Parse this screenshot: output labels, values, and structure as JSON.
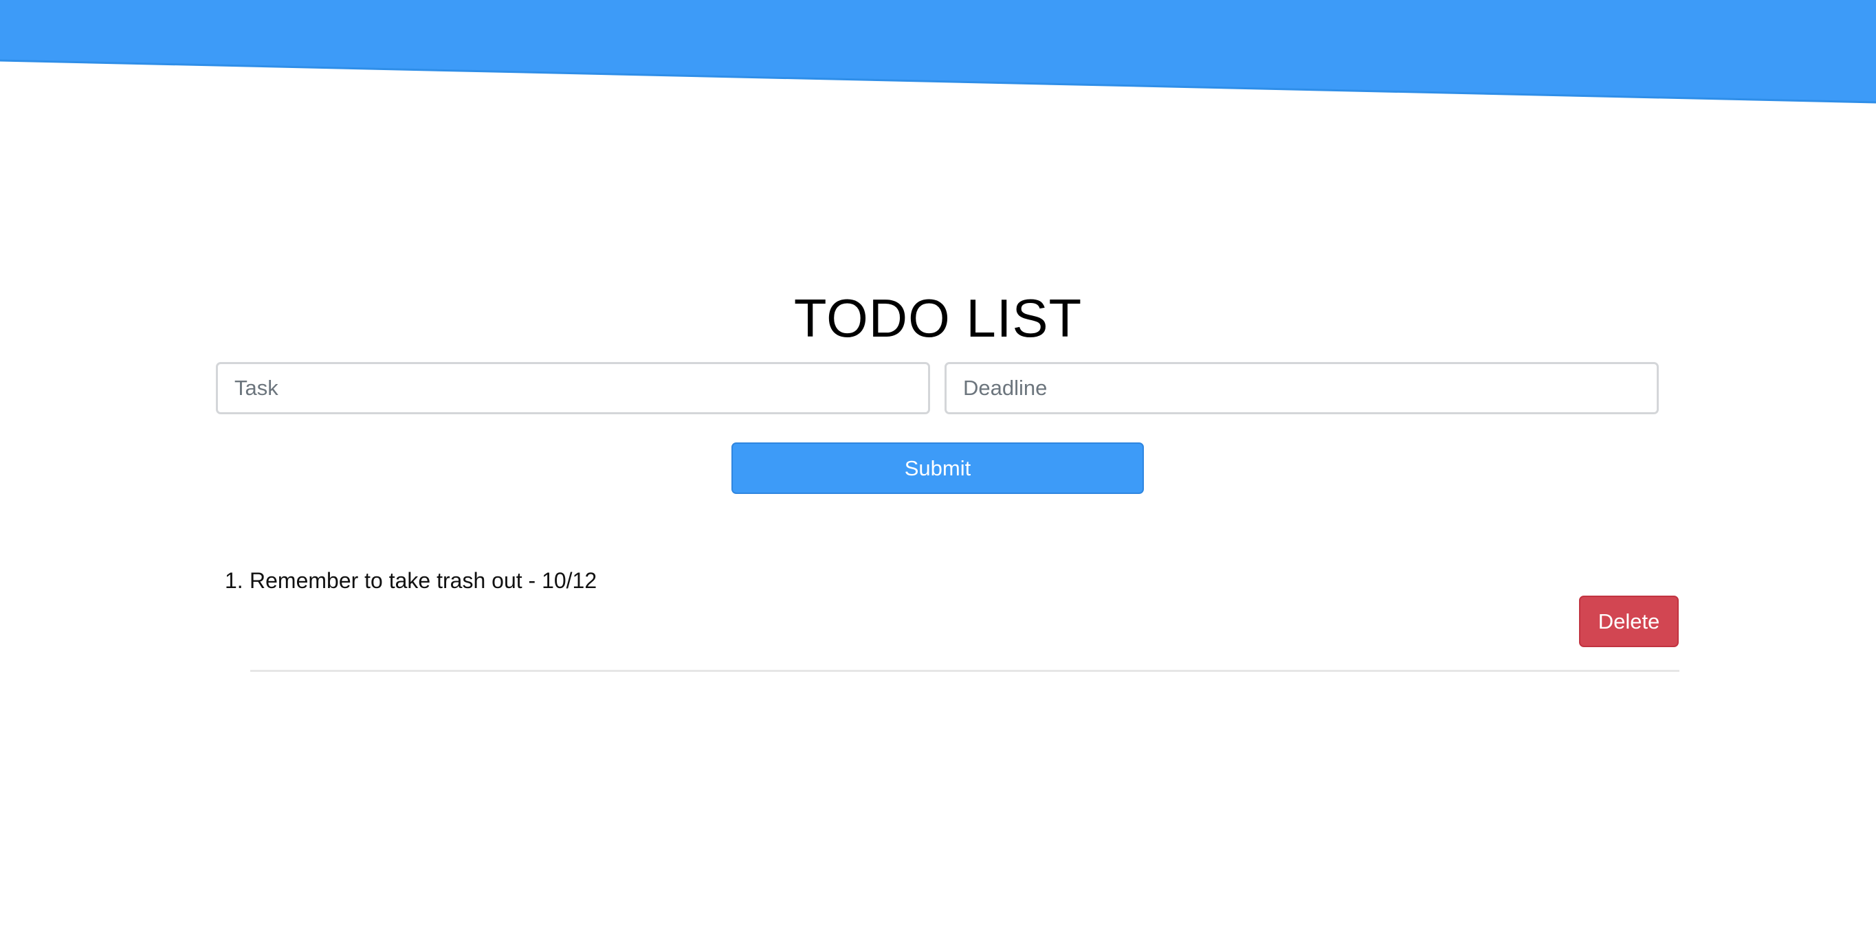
{
  "colors": {
    "banner": "#3d9bf8",
    "primary_button": "#3d9bf8",
    "danger_button": "#d24652",
    "divider": "#e6e6e6"
  },
  "header": {
    "title": "TODO LIST"
  },
  "form": {
    "task_placeholder": "Task",
    "task_value": "",
    "deadline_placeholder": "Deadline",
    "deadline_value": "",
    "submit_label": "Submit"
  },
  "todos": [
    {
      "number": "1.",
      "text": "Remember to take trash out - 10/12",
      "delete_label": "Delete"
    }
  ]
}
